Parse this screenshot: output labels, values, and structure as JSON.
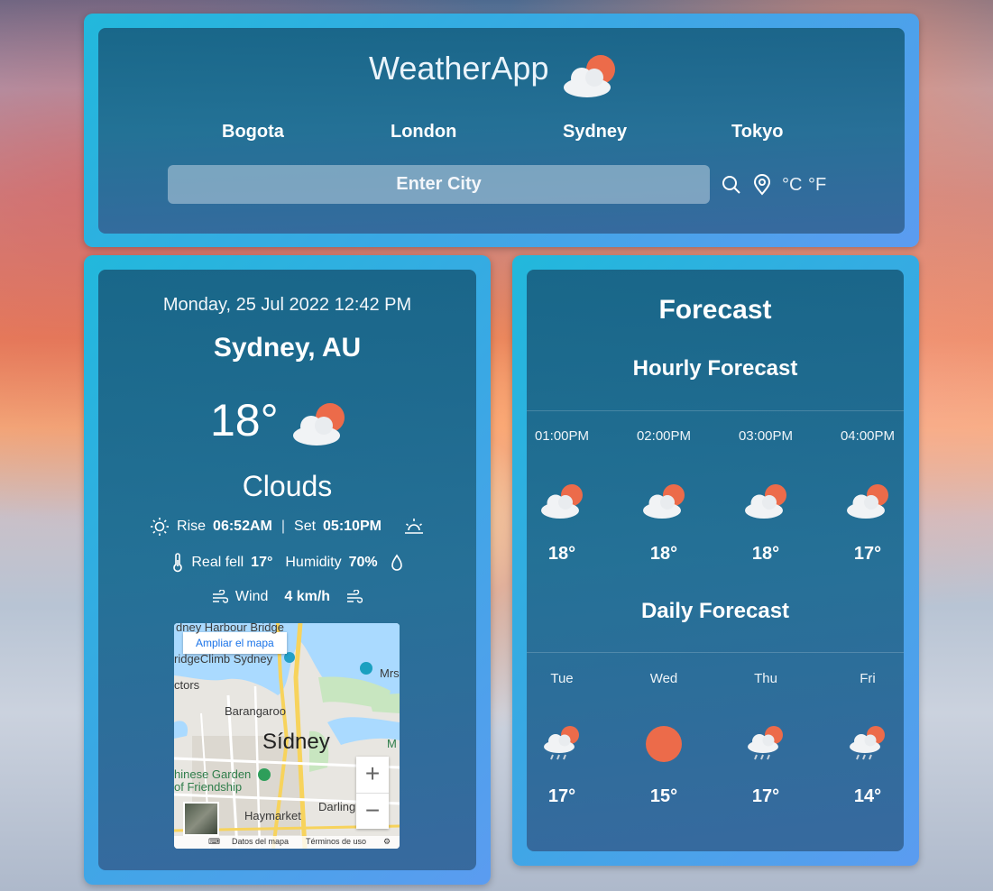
{
  "header": {
    "app_title": "WeatherApp",
    "cities": [
      "Bogota",
      "London",
      "Sydney",
      "Tokyo"
    ],
    "search_placeholder": "Enter City",
    "unit_c": "°C",
    "unit_f": "°F"
  },
  "current": {
    "datetime": "Monday, 25 Jul 2022 12:42 PM",
    "location": "Sydney, AU",
    "temperature": "18°",
    "condition": "Clouds",
    "rise_label": "Rise",
    "rise_time": "06:52AM",
    "separator": "|",
    "set_label": "Set",
    "set_time": "05:10PM",
    "real_feel_label": "Real fell",
    "real_feel_value": "17°",
    "humidity_label": "Humidity",
    "humidity_value": "70%",
    "wind_label": "Wind",
    "wind_value": "4 km/h"
  },
  "map": {
    "enlarge_button": "Ampliar el mapa",
    "labels": {
      "harbour": "dney Harbour Bridge",
      "bridgeclimb": "ridgeClimb Sydney",
      "ctors": "ctors",
      "mrs": "Mrs",
      "barangaroo": "Barangaroo",
      "city": "Sídney",
      "m": "M",
      "garden1": "hinese Garden",
      "garden2": "of Friendship",
      "darling": "Darling",
      "haymarket": "Haymarket"
    },
    "zoom_in": "+",
    "zoom_out": "−",
    "map_data": "Datos del mapa",
    "terms": "Términos de uso"
  },
  "forecast": {
    "title": "Forecast",
    "hourly_title": "Hourly Forecast",
    "daily_title": "Daily Forecast",
    "hourly": [
      {
        "label": "01:00PM",
        "temp": "18°",
        "icon": "cloud-sun-icon"
      },
      {
        "label": "02:00PM",
        "temp": "18°",
        "icon": "cloud-sun-icon"
      },
      {
        "label": "03:00PM",
        "temp": "18°",
        "icon": "cloud-sun-icon"
      },
      {
        "label": "04:00PM",
        "temp": "17°",
        "icon": "cloud-sun-icon"
      }
    ],
    "daily": [
      {
        "label": "Tue",
        "temp": "17°",
        "icon": "rain-cloud-sun-icon"
      },
      {
        "label": "Wed",
        "temp": "15°",
        "icon": "sun-icon"
      },
      {
        "label": "Thu",
        "temp": "17°",
        "icon": "rain-cloud-sun-icon"
      },
      {
        "label": "Fri",
        "temp": "14°",
        "icon": "rain-cloud-sun-icon"
      }
    ]
  },
  "colors": {
    "frame": "#2fb0e0",
    "panel": "#1c6486",
    "sun": "#ec6b4a"
  }
}
